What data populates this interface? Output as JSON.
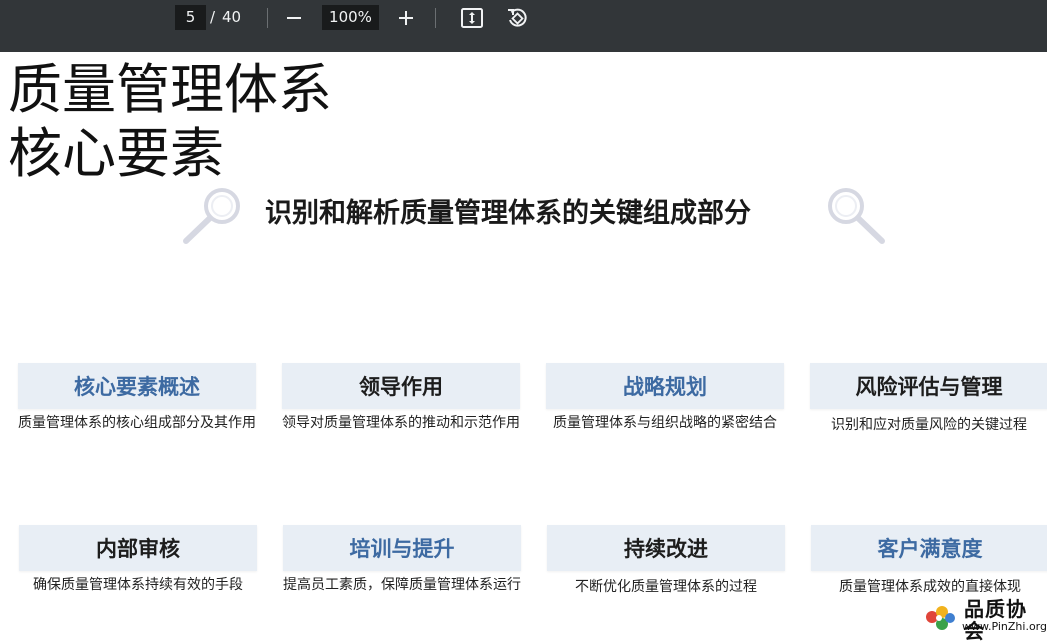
{
  "viewer": {
    "current_page": "5",
    "page_separator": "/",
    "total_pages": "40",
    "zoom": "100%",
    "icons": {
      "zoom_out": "minus-icon",
      "zoom_in": "plus-icon",
      "fit": "fit-to-page-icon",
      "rotate": "rotate-icon"
    },
    "colors": {
      "toolbar_bg": "#323639",
      "field_bg": "#191b1c"
    }
  },
  "slide": {
    "title_line1": "质量管理体系",
    "title_line2": "核心要素",
    "subtitle": "识别和解析质量管理体系的关键组成部分",
    "cards": [
      {
        "title": "核心要素概述",
        "desc": "质量管理体系的核心组成部分及其作用",
        "accent": true
      },
      {
        "title": "领导作用",
        "desc": "领导对质量管理体系的推动和示范作用",
        "accent": false
      },
      {
        "title": "战略规划",
        "desc": "质量管理体系与组织战略的紧密结合",
        "accent": true
      },
      {
        "title": "风险评估与管理",
        "desc": "识别和应对质量风险的关键过程",
        "accent": false
      },
      {
        "title": "内部审核",
        "desc": "确保质量管理体系持续有效的手段",
        "accent": false
      },
      {
        "title": "培训与提升",
        "desc": "提高员工素质，保障质量管理体系运行",
        "accent": true
      },
      {
        "title": "持续改进",
        "desc": "不断优化质量管理体系的过程",
        "accent": false
      },
      {
        "title": "客户满意度",
        "desc": "质量管理体系成效的直接体现",
        "accent": true
      }
    ],
    "colors": {
      "card_bg": "#e8eef5",
      "accent_text": "#3d6aa2"
    }
  },
  "watermark": {
    "name": "品质协会",
    "url": "www.PinZhi.org"
  }
}
